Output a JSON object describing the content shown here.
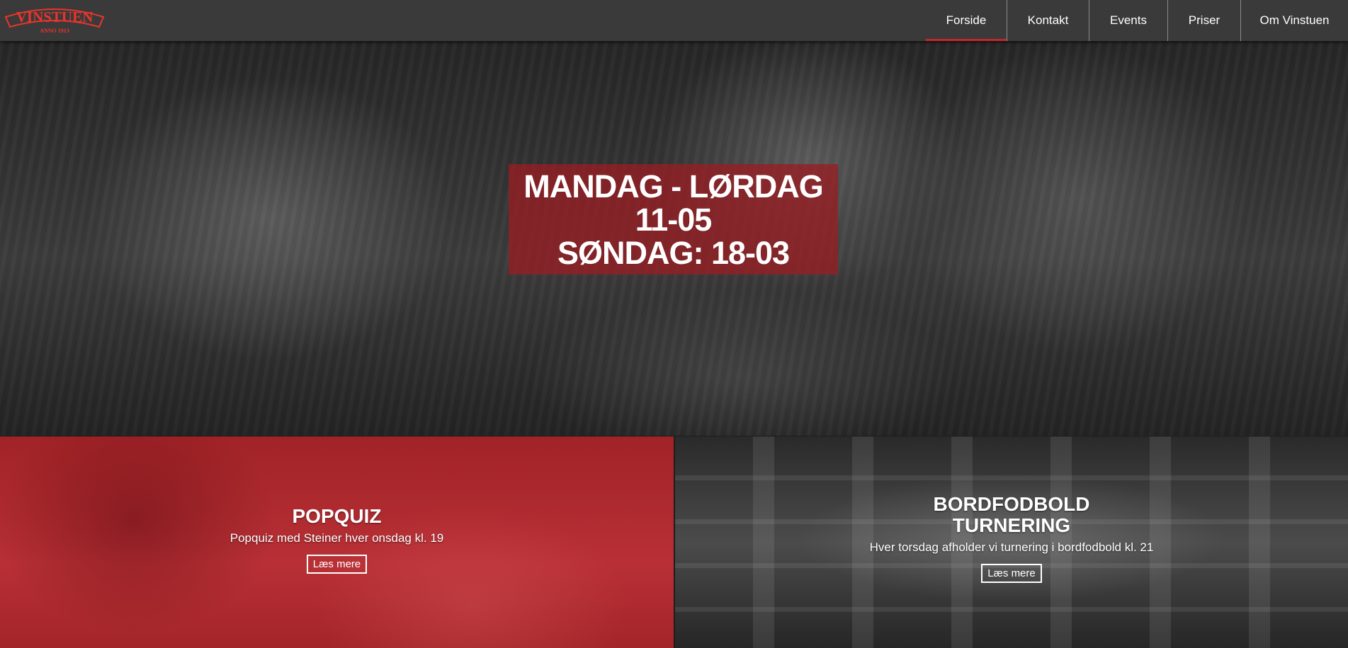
{
  "brand": {
    "logo_text": "VINSTUEN",
    "logo_tagline": "ANNO 1913",
    "logo_color": "#e8352c"
  },
  "nav": {
    "items": [
      {
        "label": "Forside",
        "active": true
      },
      {
        "label": "Kontakt",
        "active": false
      },
      {
        "label": "Events",
        "active": false
      },
      {
        "label": "Priser",
        "active": false
      },
      {
        "label": "Om Vinstuen",
        "active": false
      }
    ],
    "active_color": "#c0272d"
  },
  "hero": {
    "line1": "MANDAG - LØRDAG",
    "line2": "11-05",
    "line3": "SØNDAG: 18-03",
    "box_color": "#961e22"
  },
  "cards": {
    "quiz": {
      "title": "POPQUIZ",
      "subtitle": "Popquiz med Steiner hver onsdag kl. 19",
      "button": "Læs mere"
    },
    "bord": {
      "title_line1": "BORDFODBOLD",
      "title_line2": "TURNERING",
      "subtitle": "Hver torsdag afholder vi turnering i bordfodbold kl. 21",
      "button": "Læs mere"
    }
  }
}
